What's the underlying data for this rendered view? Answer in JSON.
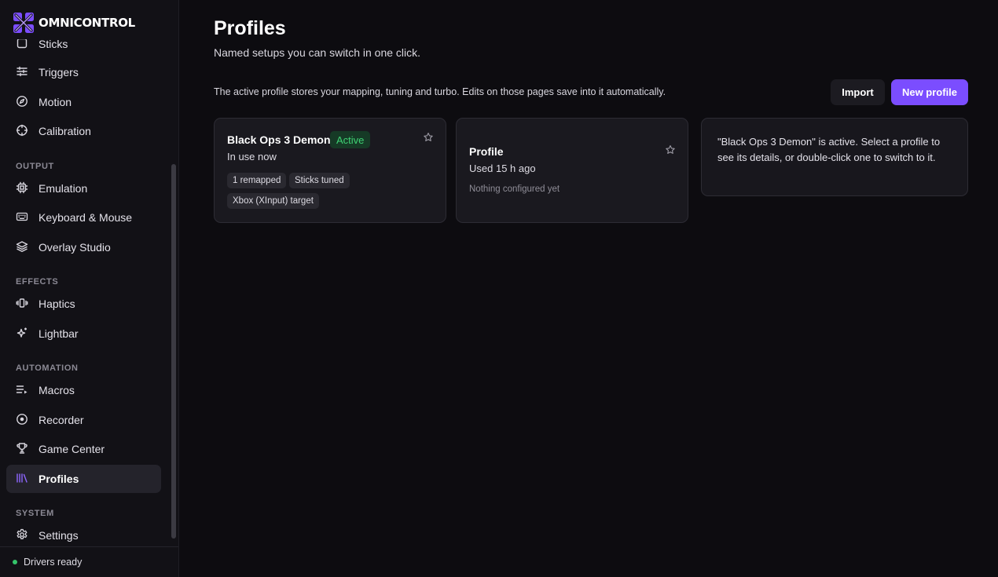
{
  "brand": {
    "name": "OMNICONTROL",
    "accent": "#7b4dff"
  },
  "sidebar": {
    "partial_item": {
      "label": "Sticks",
      "icon": "sticks-icon"
    },
    "items_top": [
      {
        "label": "Triggers",
        "icon": "sliders-icon"
      },
      {
        "label": "Motion",
        "icon": "compass-icon"
      },
      {
        "label": "Calibration",
        "icon": "crosshair-icon"
      }
    ],
    "sections": {
      "output": "OUTPUT",
      "effects": "EFFECTS",
      "automation": "AUTOMATION",
      "system": "SYSTEM"
    },
    "output_items": [
      {
        "label": "Emulation",
        "icon": "chip-icon"
      },
      {
        "label": "Keyboard & Mouse",
        "icon": "keyboard-icon"
      },
      {
        "label": "Overlay Studio",
        "icon": "layers-icon"
      }
    ],
    "effects_items": [
      {
        "label": "Haptics",
        "icon": "vibration-icon"
      },
      {
        "label": "Lightbar",
        "icon": "sparkles-icon"
      }
    ],
    "automation_items": [
      {
        "label": "Macros",
        "icon": "list-play-icon"
      },
      {
        "label": "Recorder",
        "icon": "record-icon"
      },
      {
        "label": "Game Center",
        "icon": "trophy-icon"
      },
      {
        "label": "Profiles",
        "icon": "library-icon",
        "active": true
      }
    ],
    "system_items": [
      {
        "label": "Settings",
        "icon": "gear-icon"
      }
    ],
    "footer": {
      "status": "Drivers ready",
      "status_color": "#35c46a"
    }
  },
  "main": {
    "title": "Profiles",
    "subtitle": "Named setups you can switch in one click.",
    "info": "The active profile stores your mapping, tuning and turbo. Edits on those pages save into it automatically.",
    "buttons": {
      "import": "Import",
      "new_profile": "New profile"
    },
    "profiles": [
      {
        "name": "Black Ops 3 Demon",
        "badge": "Active",
        "status": "In use now",
        "tags": [
          "1 remapped",
          "Sticks tuned",
          "Xbox (XInput) target"
        ]
      },
      {
        "name": "Profile",
        "status": "Used 15 h ago",
        "note": "Nothing configured yet"
      }
    ],
    "detail_text": "\"Black Ops 3 Demon\" is active. Select a profile to see its details, or double-click one to switch to it."
  }
}
